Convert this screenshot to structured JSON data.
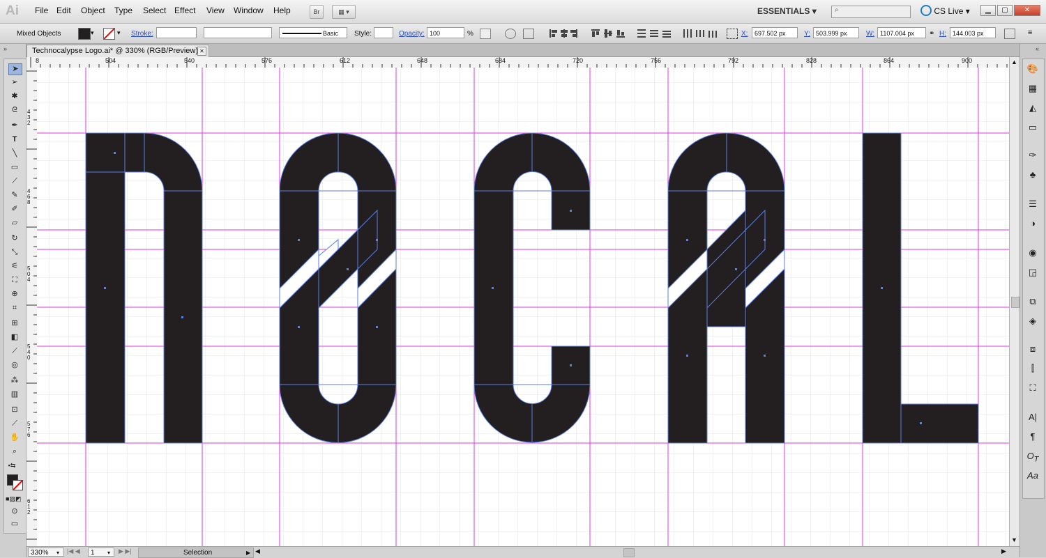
{
  "app": {
    "logo": "Ai"
  },
  "menu": [
    "File",
    "Edit",
    "Object",
    "Type",
    "Select",
    "Effect",
    "View",
    "Window",
    "Help"
  ],
  "menubar_right": {
    "bridge_label": "Br",
    "workspace": "ESSENTIALS",
    "cslive": "CS Live",
    "search_placeholder": ""
  },
  "controlbar": {
    "selection_type": "Mixed Objects",
    "stroke_label": "Stroke:",
    "stroke_weight": "",
    "brush_label": "Basic",
    "style_label": "Style:",
    "opacity_label": "Opacity:",
    "opacity_value": "100",
    "opacity_unit": "%",
    "x_label": "X:",
    "x_value": "697.502 px",
    "y_label": "Y:",
    "y_value": "503.999 px",
    "w_label": "W:",
    "w_value": "1107.004 px",
    "h_label": "H:",
    "h_value": "144.003 px"
  },
  "document": {
    "tab_title": "Technocalypse Logo.ai* @ 330% (RGB/Preview)",
    "close_glyph": "✕"
  },
  "ruler": {
    "h_labels": [
      "8",
      "504",
      "540",
      "576",
      "612",
      "648",
      "684",
      "720",
      "756",
      "792",
      "828",
      "864",
      "900"
    ],
    "v_labels": [
      "4\n3\n2",
      "4\n6\n8",
      "5\n0\n4",
      "5\n4\n0",
      "5\n7\n6",
      "6\n1\n2"
    ]
  },
  "artwork": {
    "letters": "NOCAL",
    "fill_color": "#231f20",
    "guide_color": "#e633e6",
    "path_color": "#5b7fe6",
    "grid_color": "#dcdcdc"
  },
  "statusbar": {
    "zoom": "330%",
    "artboard": "1",
    "status_text": "Selection"
  },
  "colors": {
    "accent": "#2b4ec2",
    "chrome": "#d4d4d4"
  }
}
